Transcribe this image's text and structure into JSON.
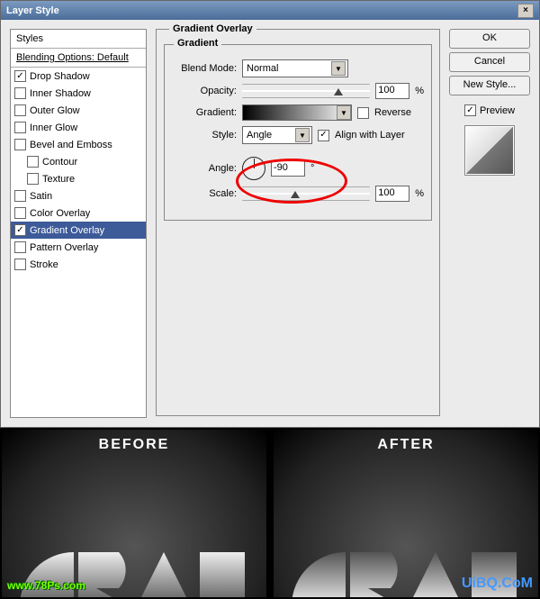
{
  "dialog": {
    "title": "Layer Style",
    "close": "×",
    "styles_panel": {
      "header": "Styles",
      "subheader": "Blending Options: Default",
      "items": [
        {
          "label": "Drop Shadow",
          "checked": true,
          "selected": false,
          "indent": false
        },
        {
          "label": "Inner Shadow",
          "checked": false,
          "selected": false,
          "indent": false
        },
        {
          "label": "Outer Glow",
          "checked": false,
          "selected": false,
          "indent": false
        },
        {
          "label": "Inner Glow",
          "checked": false,
          "selected": false,
          "indent": false
        },
        {
          "label": "Bevel and Emboss",
          "checked": false,
          "selected": false,
          "indent": false
        },
        {
          "label": "Contour",
          "checked": false,
          "selected": false,
          "indent": true
        },
        {
          "label": "Texture",
          "checked": false,
          "selected": false,
          "indent": true
        },
        {
          "label": "Satin",
          "checked": false,
          "selected": false,
          "indent": false
        },
        {
          "label": "Color Overlay",
          "checked": false,
          "selected": false,
          "indent": false
        },
        {
          "label": "Gradient Overlay",
          "checked": true,
          "selected": true,
          "indent": false
        },
        {
          "label": "Pattern Overlay",
          "checked": false,
          "selected": false,
          "indent": false
        },
        {
          "label": "Stroke",
          "checked": false,
          "selected": false,
          "indent": false
        }
      ]
    },
    "gradient_overlay": {
      "section": "Gradient Overlay",
      "legend": "Gradient",
      "blend_mode_label": "Blend Mode:",
      "blend_mode_value": "Normal",
      "opacity_label": "Opacity:",
      "opacity_value": "100",
      "opacity_unit": "%",
      "gradient_label": "Gradient:",
      "reverse_label": "Reverse",
      "reverse_checked": false,
      "style_label": "Style:",
      "style_value": "Angle",
      "align_label": "Align with Layer",
      "align_checked": true,
      "angle_label": "Angle:",
      "angle_value": "-90",
      "angle_unit": "°",
      "scale_label": "Scale:",
      "scale_value": "100",
      "scale_unit": "%"
    },
    "buttons": {
      "ok": "OK",
      "cancel": "Cancel",
      "new_style": "New Style...",
      "preview_label": "Preview",
      "preview_checked": true
    }
  },
  "comparison": {
    "before": "BEFORE",
    "after": "AFTER",
    "watermark_left": "www.78Ps.com",
    "watermark_right": "UiBQ.CoM"
  }
}
